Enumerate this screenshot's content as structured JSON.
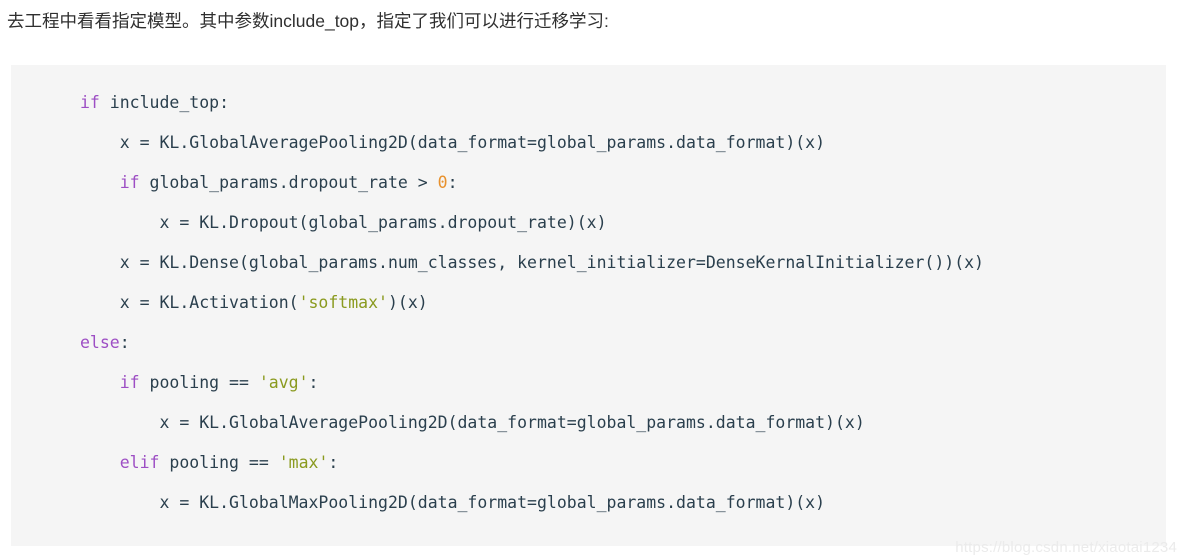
{
  "page": {
    "background_color": "#ffffff"
  },
  "intro": {
    "text": "去工程中看看指定模型。其中参数include_top，指定了我们可以进行迁移学习:"
  },
  "code_block": {
    "background_color": "#f5f5f5",
    "language": "python",
    "colors": {
      "keyword": "#9d4ec4",
      "number": "#e8912d",
      "string": "#8a9a1f",
      "default": "#2a3f4d"
    },
    "lines": [
      {
        "indent": 0,
        "tokens": [
          {
            "t": "if",
            "c": "kw"
          },
          {
            "t": " include_top:",
            "c": "def"
          }
        ]
      },
      {
        "indent": 1,
        "tokens": [
          {
            "t": "x = KL.GlobalAveragePooling2D(data_format=global_params.data_format)(x)",
            "c": "def"
          }
        ]
      },
      {
        "indent": 1,
        "tokens": [
          {
            "t": "if",
            "c": "kw"
          },
          {
            "t": " global_params.dropout_rate > ",
            "c": "def"
          },
          {
            "t": "0",
            "c": "num"
          },
          {
            "t": ":",
            "c": "def"
          }
        ]
      },
      {
        "indent": 2,
        "tokens": [
          {
            "t": "x = KL.Dropout(global_params.dropout_rate)(x)",
            "c": "def"
          }
        ]
      },
      {
        "indent": 1,
        "tokens": [
          {
            "t": "x = KL.Dense(global_params.num_classes, kernel_initializer=DenseKernalInitializer())(x)",
            "c": "def"
          }
        ]
      },
      {
        "indent": 1,
        "tokens": [
          {
            "t": "x = KL.Activation(",
            "c": "def"
          },
          {
            "t": "'softmax'",
            "c": "str"
          },
          {
            "t": ")(x)",
            "c": "def"
          }
        ]
      },
      {
        "indent": 0,
        "tokens": [
          {
            "t": "else",
            "c": "kw"
          },
          {
            "t": ":",
            "c": "def"
          }
        ]
      },
      {
        "indent": 1,
        "tokens": [
          {
            "t": "if",
            "c": "kw"
          },
          {
            "t": " pooling == ",
            "c": "def"
          },
          {
            "t": "'avg'",
            "c": "str"
          },
          {
            "t": ":",
            "c": "def"
          }
        ]
      },
      {
        "indent": 2,
        "tokens": [
          {
            "t": "x = KL.GlobalAveragePooling2D(data_format=global_params.data_format)(x)",
            "c": "def"
          }
        ]
      },
      {
        "indent": 1,
        "tokens": [
          {
            "t": "elif",
            "c": "kw"
          },
          {
            "t": " pooling == ",
            "c": "def"
          },
          {
            "t": "'max'",
            "c": "str"
          },
          {
            "t": ":",
            "c": "def"
          }
        ]
      },
      {
        "indent": 2,
        "tokens": [
          {
            "t": "x = KL.GlobalMaxPooling2D(data_format=global_params.data_format)(x)",
            "c": "def"
          }
        ]
      }
    ]
  },
  "watermark": {
    "text": "https://blog.csdn.net/xiaotai1234"
  }
}
